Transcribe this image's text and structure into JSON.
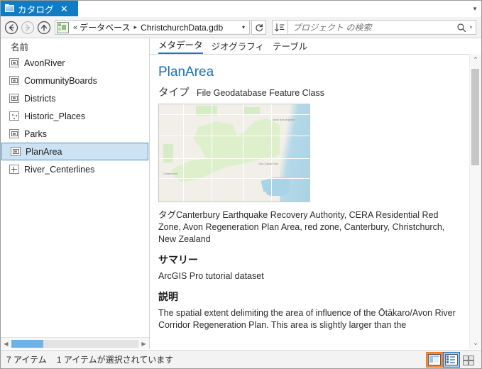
{
  "window": {
    "tab": {
      "label": "カタログ",
      "icon": "catalog-icon",
      "close": "✕"
    },
    "overflow_caret": "▾"
  },
  "toolbar": {
    "back_tooltip": "戻る",
    "forward_tooltip": "進む",
    "up_tooltip": "上へ",
    "breadcrumb": {
      "icon": "geodatabase-icon",
      "chevrons": "«",
      "items": [
        "データベース",
        "ChristchurchData.gdb"
      ],
      "separator": "▸",
      "dropdown_caret": "▾"
    },
    "refresh_label": "↻",
    "sort_icon": "sort-icon",
    "search": {
      "value": "",
      "placeholder": "プロジェクト の検索",
      "icon": "search-icon",
      "caret": "▾"
    }
  },
  "tree": {
    "column_header": "名前",
    "items": [
      {
        "label": "AvonRiver",
        "icon": "polygon-feature-class-icon",
        "selected": false
      },
      {
        "label": "CommunityBoards",
        "icon": "polygon-feature-class-icon",
        "selected": false
      },
      {
        "label": "Districts",
        "icon": "polygon-feature-class-icon",
        "selected": false
      },
      {
        "label": "Historic_Places",
        "icon": "point-feature-class-icon",
        "selected": false
      },
      {
        "label": "Parks",
        "icon": "polygon-feature-class-icon",
        "selected": false
      },
      {
        "label": "PlanArea",
        "icon": "polygon-feature-class-icon",
        "selected": true
      },
      {
        "label": "River_Centerlines",
        "icon": "line-feature-class-icon",
        "selected": false
      }
    ],
    "hscroll": {
      "left_arrow": "◀",
      "right_arrow": "▶",
      "thumb_percent": 25
    }
  },
  "detail": {
    "tabs": [
      {
        "label": "メタデータ",
        "active": true
      },
      {
        "label": "ジオグラフィ",
        "active": false
      },
      {
        "label": "テーブル",
        "active": false
      }
    ],
    "title": "PlanArea",
    "type_label": "タイプ",
    "type_value": "File Geodatabase Feature Class",
    "thumbnail_alt": "PlanArea のサムネイル マップ",
    "tags_label": "タグ",
    "tags_value": "Canterbury Earthquake Recovery Authority, CERA Residential Red Zone, Avon Regeneration Plan Area, red zone, Canterbury, Christchurch, New Zealand",
    "summary_heading": "サマリー",
    "summary_text": "ArcGIS Pro tutorial dataset",
    "description_heading": "説明",
    "description_text": "The spatial extent delimiting the area of influence of the Ōtākaro/Avon River Corridor Regeneration Plan. This area is slightly larger than the",
    "vscroll": {
      "up_arrow": "⌃",
      "down_arrow": "⌄"
    }
  },
  "status": {
    "item_count": "7 アイテム",
    "selection": "1 アイテムが選択されています",
    "views": [
      {
        "name": "details-view-button",
        "icon": "details-view-icon",
        "state": "hover"
      },
      {
        "name": "list-view-button",
        "icon": "list-view-icon",
        "state": "active"
      },
      {
        "name": "tile-view-button",
        "icon": "tile-view-icon",
        "state": "plain"
      }
    ]
  },
  "colors": {
    "accent_blue": "#0f7cc4",
    "selection_blue": "#cde3f4",
    "hover_orange": "#ef8b3c",
    "title_blue": "#1a6fb4",
    "toolbar_grey": "#f3f3f3"
  }
}
